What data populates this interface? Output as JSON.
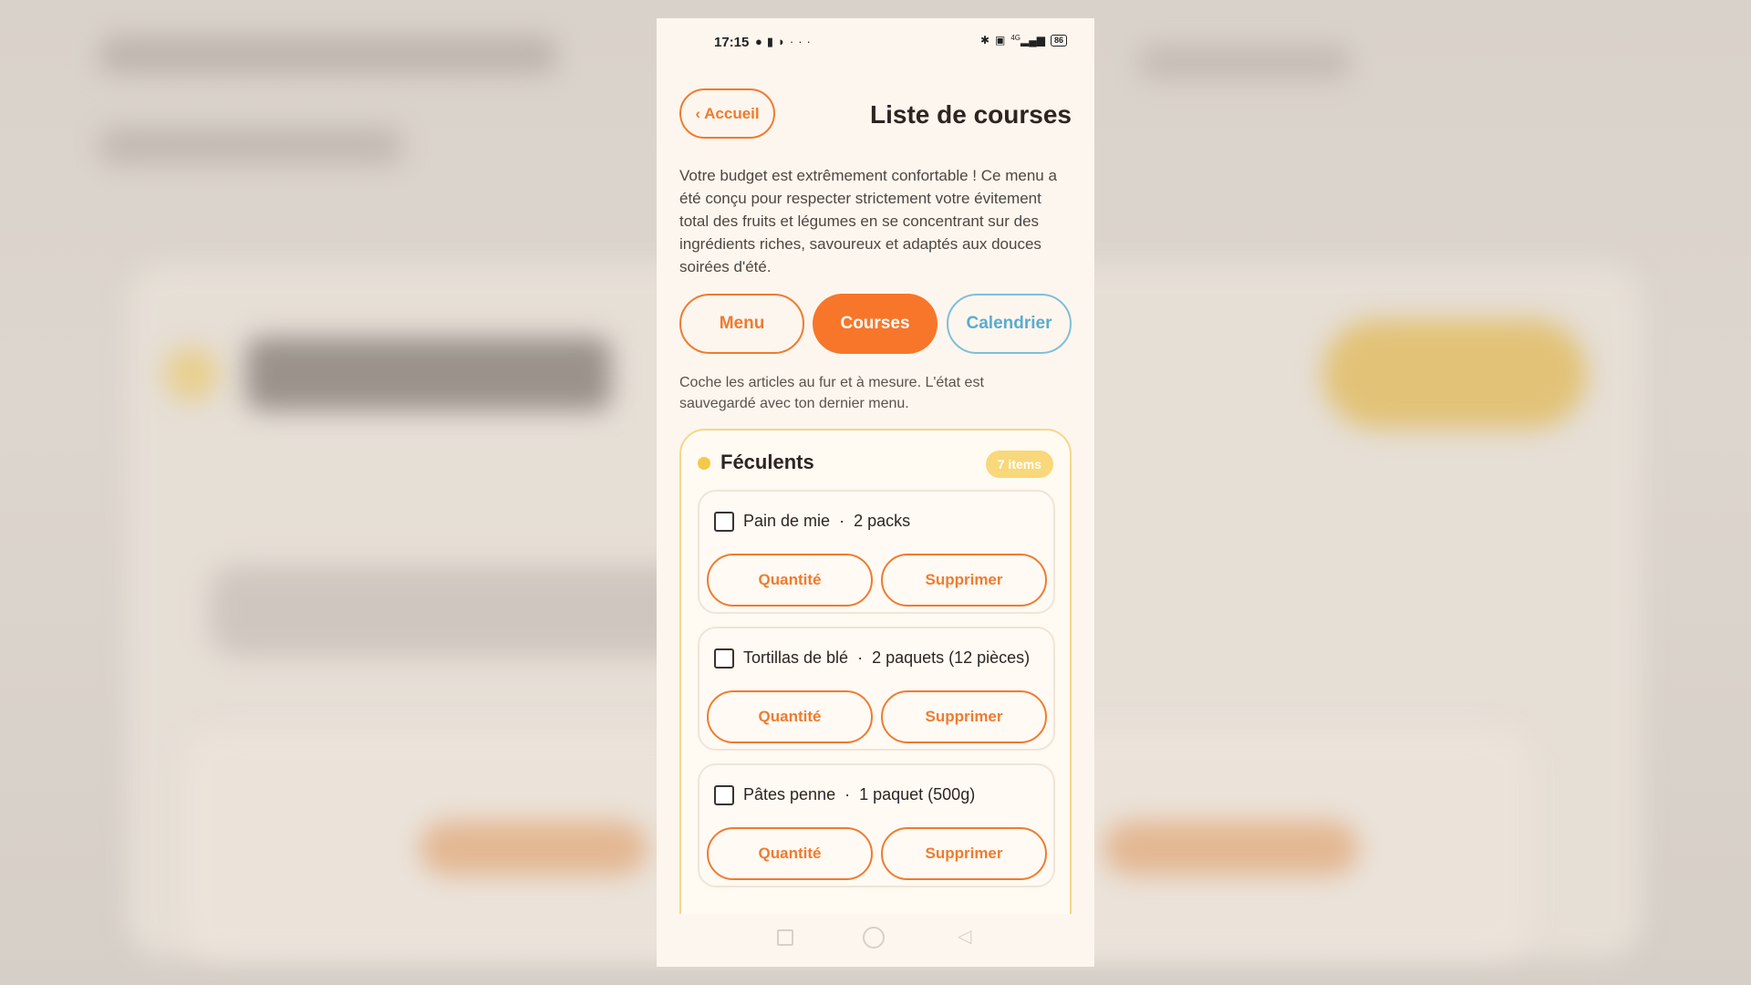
{
  "status_bar": {
    "time": "17:15",
    "left_icons": [
      "spotify-icon",
      "trash-icon",
      "media-icon",
      "more-dots-icon"
    ],
    "right_icons": [
      "bluetooth-icon",
      "volte-icon",
      "signal-4g-icon"
    ],
    "network": "4G",
    "battery": "86"
  },
  "header": {
    "back_label": "‹ Accueil",
    "title": "Liste de courses"
  },
  "intro_text": "Votre budget est extrêmement confortable ! Ce menu a été conçu pour respecter strictement votre évitement total des fruits et légumes en se concentrant sur des ingrédients riches, savoureux et adaptés aux douces soirées d'été.",
  "tabs": [
    {
      "label": "Menu",
      "active": false
    },
    {
      "label": "Courses",
      "active": true
    },
    {
      "label": "Calendrier",
      "active": false
    }
  ],
  "hint_text": "Coche les articles au fur et à mesure. L'état est sauvegardé avec ton dernier menu.",
  "category": {
    "title": "Féculents",
    "badge": "7 items",
    "items": [
      {
        "name": "Pain de mie",
        "quantity": "2 packs",
        "checked": false,
        "qty_button": "Quantité",
        "delete_button": "Supprimer"
      },
      {
        "name": "Tortillas de blé",
        "quantity": "2 paquets (12 pièces)",
        "checked": false,
        "qty_button": "Quantité",
        "delete_button": "Supprimer"
      },
      {
        "name": "Pâtes penne",
        "quantity": "1 paquet (500g)",
        "checked": false,
        "qty_button": "Quantité",
        "delete_button": "Supprimer"
      }
    ]
  },
  "colors": {
    "accent": "#f7762a",
    "accent_outline": "#f07b2e",
    "calendar_blue": "#59acd0",
    "category_border": "#f5d78a",
    "badge": "#f8d87a",
    "background": "#fdf6ee"
  }
}
